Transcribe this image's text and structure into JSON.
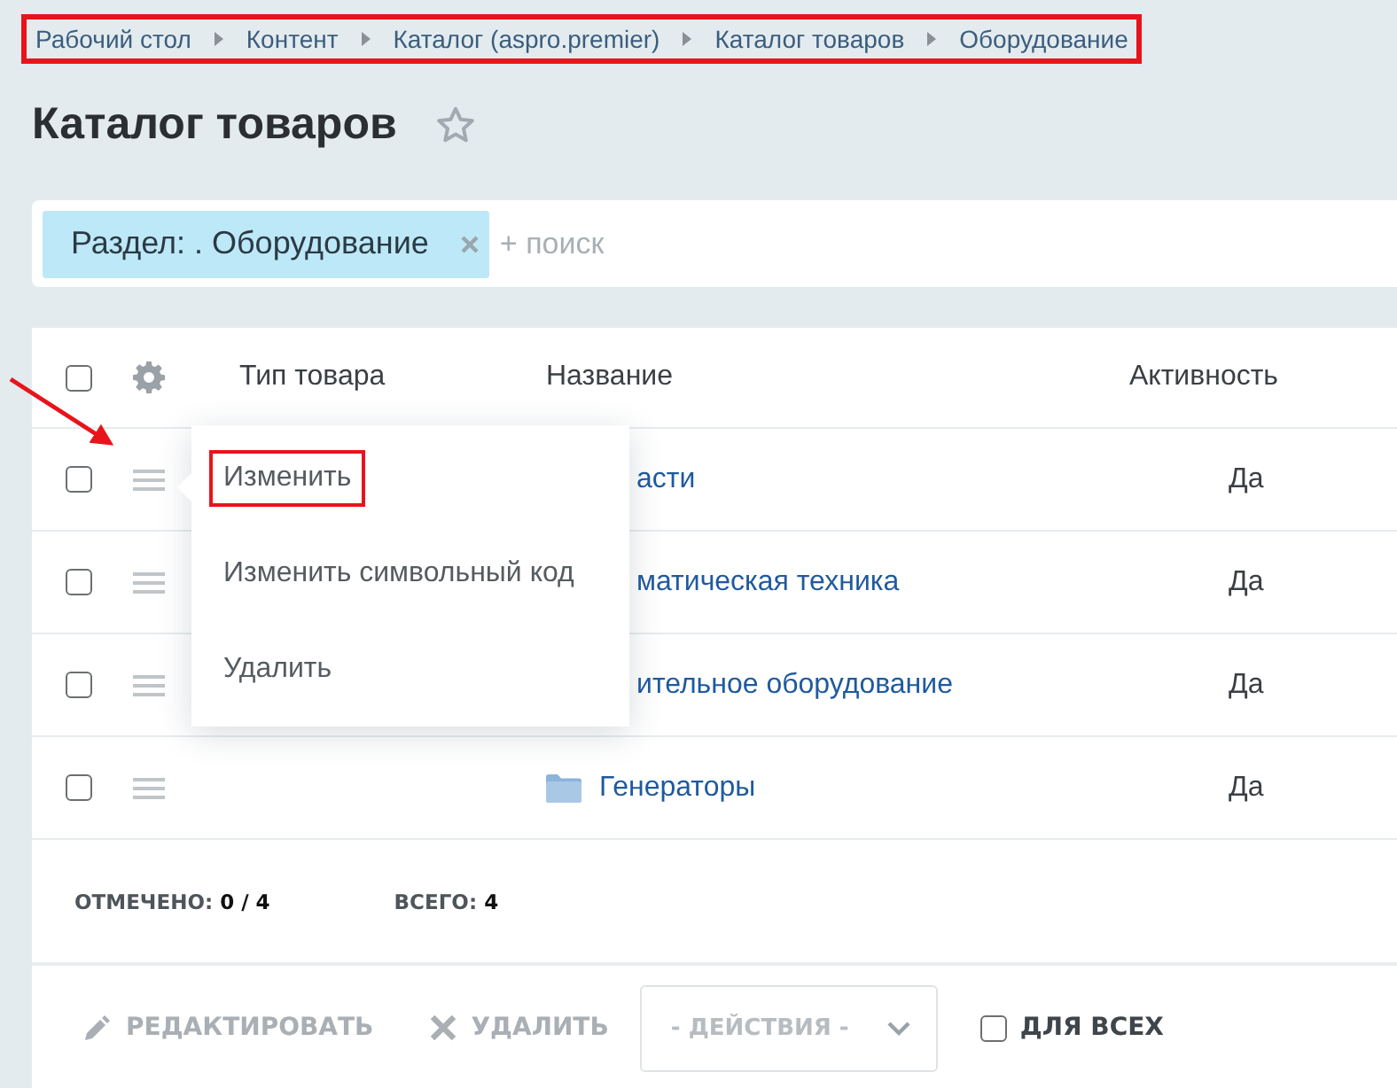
{
  "breadcrumbs": {
    "highlighted": true,
    "items": [
      "Рабочий стол",
      "Контент",
      "Каталог (aspro.premier)",
      "Каталог товаров",
      "Оборудование"
    ]
  },
  "title": "Каталог товаров",
  "favorite": false,
  "filter": {
    "tag": "Раздел: . Оборудование",
    "placeholder": "+ поиск"
  },
  "table": {
    "all_checked": false,
    "columns": [
      "Тип товара",
      "Название",
      "Активность"
    ],
    "rows": [
      {
        "checked": false,
        "name": "асти",
        "active": "Да"
      },
      {
        "checked": false,
        "name": "матическая техника",
        "active": "Да"
      },
      {
        "checked": false,
        "name": "ительное оборудование",
        "active": "Да"
      },
      {
        "checked": false,
        "name": "Генераторы",
        "active": "Да"
      }
    ]
  },
  "context_menu": {
    "items": [
      {
        "label": "Изменить",
        "highlighted": true
      },
      {
        "label": "Изменить символьный код",
        "highlighted": false
      },
      {
        "label": "Удалить",
        "highlighted": false
      }
    ]
  },
  "footer": {
    "selected_label": "ОТМЕЧЕНО:",
    "selected_value": "0 / 4",
    "total_label": "ВСЕГО:",
    "total_value": "4"
  },
  "actions": {
    "edit": "РЕДАКТИРОВАТЬ",
    "delete": "УДАЛИТЬ",
    "select_placeholder": "- ДЕЙСТВИЯ -",
    "for_all": {
      "label": "ДЛЯ ВСЕХ",
      "checked": false
    }
  }
}
